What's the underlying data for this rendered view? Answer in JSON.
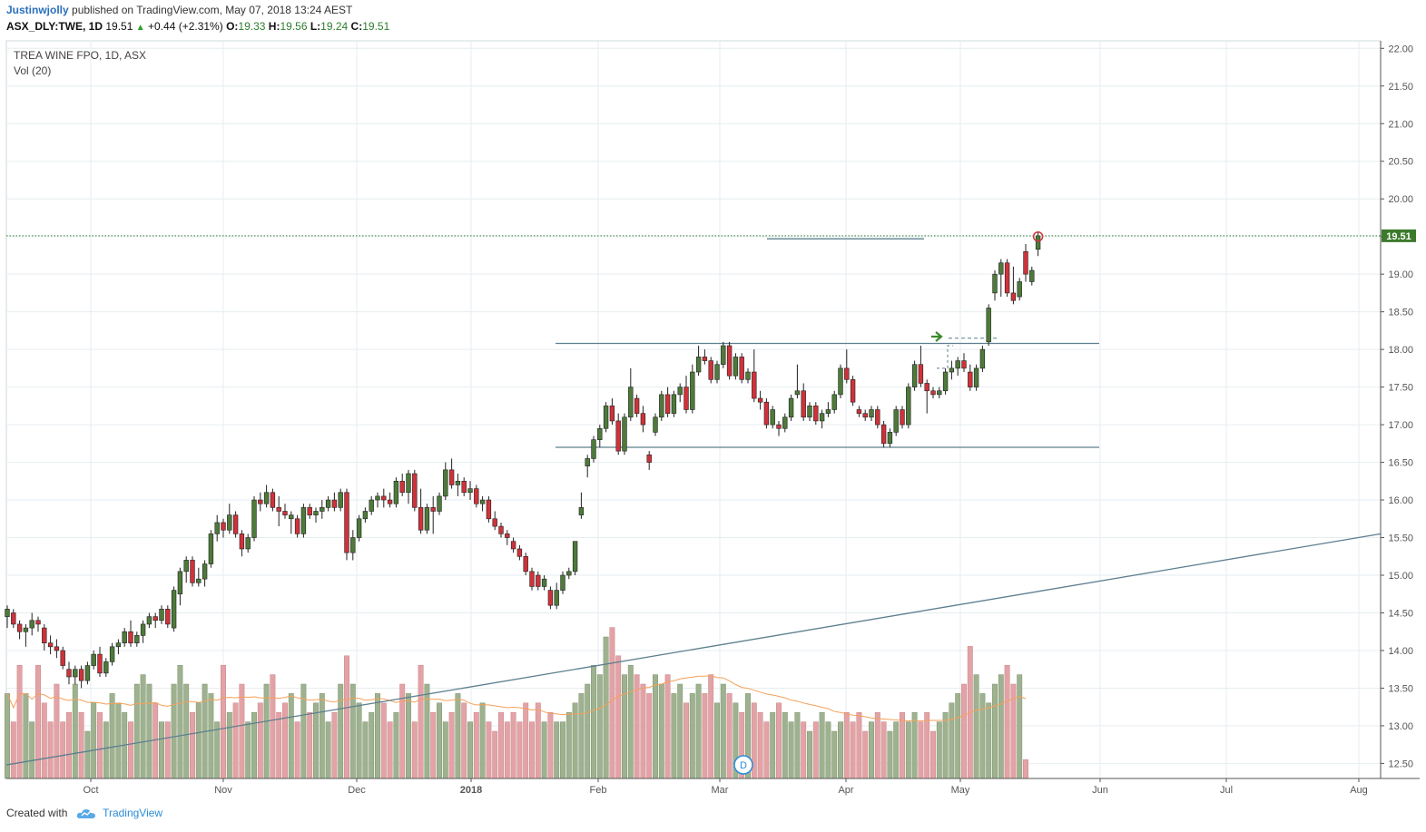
{
  "header": {
    "author": "Justinwjolly",
    "published_text": "published on TradingView.com, May 07, 2018 13:24 AEST",
    "symbol": "ASX_DLY:TWE, 1D",
    "last": "19.51",
    "change": "+0.44 (+2.31%)",
    "open_label": "O:",
    "open": "19.33",
    "high_label": "H:",
    "high": "19.56",
    "low_label": "L:",
    "low": "19.24",
    "close_label": "C:",
    "close": "19.51"
  },
  "legend": {
    "main_series": "TREA WINE FPO, 1D, ASX",
    "volume_series": "Vol (20)"
  },
  "footer": {
    "created_with": "Created with",
    "brand": "TradingView"
  },
  "colors": {
    "up_candle": "#4e7a3a",
    "down_candle": "#d0323a",
    "up_volume": "#9fb28f",
    "down_volume": "#e3a3a6",
    "volume_ma": "#f5a15a",
    "drawing_lines": "#5c7f8e",
    "last_price_line": "#2e7d32",
    "last_price_badge": "#3c7a2c",
    "grid": "#e6eef0"
  },
  "chart_data": {
    "type": "candlestick",
    "symbol": "TWE",
    "interval": "1D",
    "y_axis": {
      "range": [
        12.3,
        22.1
      ],
      "ticks": [
        "12.50",
        "13.00",
        "13.50",
        "14.00",
        "14.50",
        "15.00",
        "15.50",
        "16.00",
        "16.50",
        "17.00",
        "17.50",
        "18.00",
        "18.50",
        "19.00",
        "19.50",
        "20.00",
        "20.50",
        "21.00",
        "21.50",
        "22.00"
      ],
      "last_price_label": "19.51"
    },
    "x_axis": {
      "ticks": [
        "Oct",
        "Nov",
        "Dec",
        "2018",
        "Feb",
        "Mar",
        "Apr",
        "May",
        "Jun",
        "Jul",
        "Aug"
      ]
    },
    "dividend_marker": "D",
    "horizontal_lines": [
      {
        "value": 18.08,
        "from": "2018-01-24",
        "to": "2018-06-01"
      },
      {
        "value": 16.7,
        "from": "2018-01-24",
        "to": "2018-06-01"
      },
      {
        "value": 19.47,
        "from": "2018-03-08",
        "to": "2018-04-24"
      }
    ],
    "trendline": {
      "start_date": "2017-09-13",
      "start_value": 12.48,
      "end_date": "2018-08-01",
      "end_value": 15.55
    },
    "volume_max": 1.0,
    "candles": [
      {
        "o": 14.45,
        "h": 14.6,
        "l": 14.3,
        "c": 14.55
      },
      {
        "o": 14.5,
        "h": 14.55,
        "l": 14.3,
        "c": 14.35
      },
      {
        "o": 14.35,
        "h": 14.4,
        "l": 14.15,
        "c": 14.25
      },
      {
        "o": 14.25,
        "h": 14.35,
        "l": 14.05,
        "c": 14.3
      },
      {
        "o": 14.3,
        "h": 14.5,
        "l": 14.2,
        "c": 14.4
      },
      {
        "o": 14.4,
        "h": 14.45,
        "l": 14.25,
        "c": 14.35
      },
      {
        "o": 14.3,
        "h": 14.35,
        "l": 14.0,
        "c": 14.1
      },
      {
        "o": 14.1,
        "h": 14.2,
        "l": 13.95,
        "c": 14.05
      },
      {
        "o": 14.05,
        "h": 14.15,
        "l": 13.9,
        "c": 14.0
      },
      {
        "o": 14.0,
        "h": 14.05,
        "l": 13.75,
        "c": 13.8
      },
      {
        "o": 13.75,
        "h": 13.85,
        "l": 13.55,
        "c": 13.65
      },
      {
        "o": 13.65,
        "h": 13.8,
        "l": 13.55,
        "c": 13.75
      },
      {
        "o": 13.75,
        "h": 13.8,
        "l": 13.5,
        "c": 13.6
      },
      {
        "o": 13.6,
        "h": 13.85,
        "l": 13.55,
        "c": 13.8
      },
      {
        "o": 13.8,
        "h": 14.0,
        "l": 13.75,
        "c": 13.95
      },
      {
        "o": 13.95,
        "h": 14.05,
        "l": 13.65,
        "c": 13.7
      },
      {
        "o": 13.7,
        "h": 13.9,
        "l": 13.65,
        "c": 13.85
      },
      {
        "o": 13.85,
        "h": 14.1,
        "l": 13.8,
        "c": 14.05
      },
      {
        "o": 14.05,
        "h": 14.15,
        "l": 13.95,
        "c": 14.1
      },
      {
        "o": 14.1,
        "h": 14.3,
        "l": 14.05,
        "c": 14.25
      },
      {
        "o": 14.25,
        "h": 14.4,
        "l": 14.05,
        "c": 14.1
      },
      {
        "o": 14.1,
        "h": 14.25,
        "l": 14.05,
        "c": 14.2
      },
      {
        "o": 14.2,
        "h": 14.4,
        "l": 14.1,
        "c": 14.35
      },
      {
        "o": 14.35,
        "h": 14.5,
        "l": 14.3,
        "c": 14.45
      },
      {
        "o": 14.45,
        "h": 14.5,
        "l": 14.3,
        "c": 14.4
      },
      {
        "o": 14.4,
        "h": 14.6,
        "l": 14.35,
        "c": 14.55
      },
      {
        "o": 14.55,
        "h": 14.6,
        "l": 14.3,
        "c": 14.35
      },
      {
        "o": 14.3,
        "h": 14.85,
        "l": 14.25,
        "c": 14.8
      },
      {
        "o": 14.75,
        "h": 15.1,
        "l": 14.6,
        "c": 15.05
      },
      {
        "o": 15.05,
        "h": 15.25,
        "l": 14.9,
        "c": 15.2
      },
      {
        "o": 15.2,
        "h": 15.25,
        "l": 14.85,
        "c": 14.9
      },
      {
        "o": 14.9,
        "h": 15.1,
        "l": 14.85,
        "c": 14.95
      },
      {
        "o": 14.95,
        "h": 15.2,
        "l": 14.85,
        "c": 15.15
      },
      {
        "o": 15.15,
        "h": 15.6,
        "l": 15.1,
        "c": 15.55
      },
      {
        "o": 15.55,
        "h": 15.8,
        "l": 15.45,
        "c": 15.7
      },
      {
        "o": 15.7,
        "h": 15.75,
        "l": 15.5,
        "c": 15.6
      },
      {
        "o": 15.6,
        "h": 15.95,
        "l": 15.55,
        "c": 15.8
      },
      {
        "o": 15.8,
        "h": 15.85,
        "l": 15.5,
        "c": 15.55
      },
      {
        "o": 15.55,
        "h": 15.6,
        "l": 15.25,
        "c": 15.35
      },
      {
        "o": 15.35,
        "h": 15.55,
        "l": 15.3,
        "c": 15.5
      },
      {
        "o": 15.5,
        "h": 16.05,
        "l": 15.45,
        "c": 16.0
      },
      {
        "o": 16.0,
        "h": 16.1,
        "l": 15.85,
        "c": 15.95
      },
      {
        "o": 15.95,
        "h": 16.2,
        "l": 15.9,
        "c": 16.1
      },
      {
        "o": 16.1,
        "h": 16.15,
        "l": 15.85,
        "c": 15.9
      },
      {
        "o": 15.9,
        "h": 16.05,
        "l": 15.65,
        "c": 15.85
      },
      {
        "o": 15.85,
        "h": 15.95,
        "l": 15.75,
        "c": 15.8
      },
      {
        "o": 15.75,
        "h": 15.85,
        "l": 15.55,
        "c": 15.8
      },
      {
        "o": 15.75,
        "h": 15.8,
        "l": 15.5,
        "c": 15.55
      },
      {
        "o": 15.55,
        "h": 15.95,
        "l": 15.5,
        "c": 15.9
      },
      {
        "o": 15.9,
        "h": 15.95,
        "l": 15.75,
        "c": 15.8
      },
      {
        "o": 15.8,
        "h": 15.9,
        "l": 15.7,
        "c": 15.85
      },
      {
        "o": 15.85,
        "h": 16.0,
        "l": 15.75,
        "c": 15.9
      },
      {
        "o": 15.9,
        "h": 16.05,
        "l": 15.85,
        "c": 16.0
      },
      {
        "o": 16.0,
        "h": 16.1,
        "l": 15.85,
        "c": 15.9
      },
      {
        "o": 15.9,
        "h": 16.15,
        "l": 15.85,
        "c": 16.1
      },
      {
        "o": 16.1,
        "h": 16.15,
        "l": 15.2,
        "c": 15.3
      },
      {
        "o": 15.3,
        "h": 15.6,
        "l": 15.2,
        "c": 15.5
      },
      {
        "o": 15.5,
        "h": 15.8,
        "l": 15.45,
        "c": 15.75
      },
      {
        "o": 15.75,
        "h": 15.9,
        "l": 15.7,
        "c": 15.85
      },
      {
        "o": 15.85,
        "h": 16.05,
        "l": 15.8,
        "c": 16.0
      },
      {
        "o": 16.0,
        "h": 16.1,
        "l": 15.9,
        "c": 16.05
      },
      {
        "o": 16.05,
        "h": 16.15,
        "l": 15.9,
        "c": 16.0
      },
      {
        "o": 16.0,
        "h": 16.1,
        "l": 15.9,
        "c": 15.95
      },
      {
        "o": 15.95,
        "h": 16.3,
        "l": 15.9,
        "c": 16.25
      },
      {
        "o": 16.25,
        "h": 16.35,
        "l": 16.05,
        "c": 16.1
      },
      {
        "o": 16.1,
        "h": 16.4,
        "l": 15.95,
        "c": 16.35
      },
      {
        "o": 16.35,
        "h": 16.4,
        "l": 15.85,
        "c": 15.9
      },
      {
        "o": 15.9,
        "h": 16.15,
        "l": 15.55,
        "c": 15.6
      },
      {
        "o": 15.6,
        "h": 15.95,
        "l": 15.55,
        "c": 15.9
      },
      {
        "o": 15.9,
        "h": 16.05,
        "l": 15.55,
        "c": 15.85
      },
      {
        "o": 15.85,
        "h": 16.1,
        "l": 15.8,
        "c": 16.05
      },
      {
        "o": 16.05,
        "h": 16.5,
        "l": 16.0,
        "c": 16.4
      },
      {
        "o": 16.4,
        "h": 16.55,
        "l": 16.15,
        "c": 16.2
      },
      {
        "o": 16.2,
        "h": 16.35,
        "l": 16.05,
        "c": 16.25
      },
      {
        "o": 16.25,
        "h": 16.3,
        "l": 16.05,
        "c": 16.1
      },
      {
        "o": 16.1,
        "h": 16.25,
        "l": 16.0,
        "c": 16.15
      },
      {
        "o": 16.15,
        "h": 16.2,
        "l": 15.9,
        "c": 15.95
      },
      {
        "o": 15.95,
        "h": 16.05,
        "l": 15.85,
        "c": 16.0
      },
      {
        "o": 16.0,
        "h": 16.05,
        "l": 15.7,
        "c": 15.75
      },
      {
        "o": 15.75,
        "h": 15.85,
        "l": 15.6,
        "c": 15.65
      },
      {
        "o": 15.65,
        "h": 15.7,
        "l": 15.5,
        "c": 15.55
      },
      {
        "o": 15.55,
        "h": 15.6,
        "l": 15.4,
        "c": 15.5
      },
      {
        "o": 15.45,
        "h": 15.5,
        "l": 15.3,
        "c": 15.35
      },
      {
        "o": 15.35,
        "h": 15.4,
        "l": 15.2,
        "c": 15.25
      },
      {
        "o": 15.25,
        "h": 15.3,
        "l": 15.0,
        "c": 15.05
      },
      {
        "o": 15.05,
        "h": 15.1,
        "l": 14.8,
        "c": 14.85
      },
      {
        "o": 15.0,
        "h": 15.05,
        "l": 14.8,
        "c": 14.85
      },
      {
        "o": 14.85,
        "h": 15.0,
        "l": 14.8,
        "c": 14.95
      },
      {
        "o": 14.8,
        "h": 14.85,
        "l": 14.55,
        "c": 14.6
      },
      {
        "o": 14.6,
        "h": 14.9,
        "l": 14.55,
        "c": 14.8
      },
      {
        "o": 14.8,
        "h": 15.05,
        "l": 14.75,
        "c": 15.0
      },
      {
        "o": 15.0,
        "h": 15.1,
        "l": 14.95,
        "c": 15.05
      },
      {
        "o": 15.05,
        "h": 15.45,
        "l": 15.0,
        "c": 15.45
      },
      {
        "o": 15.8,
        "h": 16.1,
        "l": 15.75,
        "c": 15.9
      },
      {
        "o": 16.45,
        "h": 16.6,
        "l": 16.3,
        "c": 16.55
      },
      {
        "o": 16.55,
        "h": 16.85,
        "l": 16.5,
        "c": 16.8
      },
      {
        "o": 16.8,
        "h": 17.0,
        "l": 16.7,
        "c": 16.95
      },
      {
        "o": 16.95,
        "h": 17.3,
        "l": 16.9,
        "c": 17.25
      },
      {
        "o": 17.25,
        "h": 17.35,
        "l": 17.0,
        "c": 17.05
      },
      {
        "o": 17.05,
        "h": 17.15,
        "l": 16.6,
        "c": 16.65
      },
      {
        "o": 16.65,
        "h": 17.15,
        "l": 16.6,
        "c": 17.1
      },
      {
        "o": 17.1,
        "h": 17.75,
        "l": 17.05,
        "c": 17.5
      },
      {
        "o": 17.35,
        "h": 17.4,
        "l": 17.1,
        "c": 17.15
      },
      {
        "o": 17.15,
        "h": 17.25,
        "l": 16.9,
        "c": 17.0
      },
      {
        "o": 16.6,
        "h": 16.65,
        "l": 16.4,
        "c": 16.5
      },
      {
        "o": 16.9,
        "h": 17.15,
        "l": 16.85,
        "c": 17.1
      },
      {
        "o": 17.1,
        "h": 17.45,
        "l": 17.05,
        "c": 17.4
      },
      {
        "o": 17.4,
        "h": 17.5,
        "l": 17.1,
        "c": 17.15
      },
      {
        "o": 17.15,
        "h": 17.45,
        "l": 17.1,
        "c": 17.4
      },
      {
        "o": 17.4,
        "h": 17.55,
        "l": 17.3,
        "c": 17.5
      },
      {
        "o": 17.5,
        "h": 17.65,
        "l": 17.15,
        "c": 17.2
      },
      {
        "o": 17.2,
        "h": 17.8,
        "l": 17.15,
        "c": 17.7
      },
      {
        "o": 17.7,
        "h": 18.05,
        "l": 17.65,
        "c": 17.9
      },
      {
        "o": 17.9,
        "h": 18.0,
        "l": 17.8,
        "c": 17.85
      },
      {
        "o": 17.85,
        "h": 17.9,
        "l": 17.55,
        "c": 17.6
      },
      {
        "o": 17.6,
        "h": 17.85,
        "l": 17.55,
        "c": 17.8
      },
      {
        "o": 17.8,
        "h": 18.1,
        "l": 17.75,
        "c": 18.05
      },
      {
        "o": 18.05,
        "h": 18.1,
        "l": 17.6,
        "c": 17.65
      },
      {
        "o": 17.65,
        "h": 17.95,
        "l": 17.6,
        "c": 17.9
      },
      {
        "o": 17.9,
        "h": 17.95,
        "l": 17.55,
        "c": 17.6
      },
      {
        "o": 17.6,
        "h": 17.75,
        "l": 17.55,
        "c": 17.7
      },
      {
        "o": 17.7,
        "h": 18.0,
        "l": 17.3,
        "c": 17.35
      },
      {
        "o": 17.35,
        "h": 17.45,
        "l": 17.2,
        "c": 17.3
      },
      {
        "o": 17.3,
        "h": 17.35,
        "l": 16.95,
        "c": 17.0
      },
      {
        "o": 17.0,
        "h": 17.25,
        "l": 16.95,
        "c": 17.2
      },
      {
        "o": 17.0,
        "h": 17.05,
        "l": 16.85,
        "c": 16.95
      },
      {
        "o": 16.95,
        "h": 17.15,
        "l": 16.9,
        "c": 17.1
      },
      {
        "o": 17.1,
        "h": 17.4,
        "l": 17.05,
        "c": 17.35
      },
      {
        "o": 17.4,
        "h": 17.8,
        "l": 17.35,
        "c": 17.45
      },
      {
        "o": 17.45,
        "h": 17.55,
        "l": 17.05,
        "c": 17.1
      },
      {
        "o": 17.1,
        "h": 17.3,
        "l": 17.05,
        "c": 17.25
      },
      {
        "o": 17.25,
        "h": 17.3,
        "l": 17.0,
        "c": 17.05
      },
      {
        "o": 17.05,
        "h": 17.2,
        "l": 16.95,
        "c": 17.15
      },
      {
        "o": 17.15,
        "h": 17.3,
        "l": 17.1,
        "c": 17.2
      },
      {
        "o": 17.2,
        "h": 17.45,
        "l": 17.15,
        "c": 17.4
      },
      {
        "o": 17.4,
        "h": 17.8,
        "l": 17.35,
        "c": 17.75
      },
      {
        "o": 17.75,
        "h": 18.0,
        "l": 17.55,
        "c": 17.6
      },
      {
        "o": 17.6,
        "h": 17.65,
        "l": 17.25,
        "c": 17.3
      },
      {
        "o": 17.2,
        "h": 17.25,
        "l": 17.1,
        "c": 17.15
      },
      {
        "o": 17.15,
        "h": 17.2,
        "l": 17.05,
        "c": 17.1
      },
      {
        "o": 17.1,
        "h": 17.25,
        "l": 17.05,
        "c": 17.2
      },
      {
        "o": 17.2,
        "h": 17.25,
        "l": 16.95,
        "c": 17.0
      },
      {
        "o": 17.0,
        "h": 17.05,
        "l": 16.7,
        "c": 16.75
      },
      {
        "o": 16.75,
        "h": 16.95,
        "l": 16.7,
        "c": 16.9
      },
      {
        "o": 16.9,
        "h": 17.25,
        "l": 16.85,
        "c": 17.2
      },
      {
        "o": 17.2,
        "h": 17.25,
        "l": 16.95,
        "c": 17.0
      },
      {
        "o": 17.0,
        "h": 17.55,
        "l": 16.95,
        "c": 17.5
      },
      {
        "o": 17.5,
        "h": 17.85,
        "l": 17.45,
        "c": 17.8
      },
      {
        "o": 17.8,
        "h": 18.05,
        "l": 17.5,
        "c": 17.55
      },
      {
        "o": 17.55,
        "h": 17.6,
        "l": 17.15,
        "c": 17.45
      },
      {
        "o": 17.45,
        "h": 17.5,
        "l": 17.35,
        "c": 17.4
      },
      {
        "o": 17.4,
        "h": 17.5,
        "l": 17.35,
        "c": 17.45
      },
      {
        "o": 17.45,
        "h": 17.75,
        "l": 17.4,
        "c": 17.7
      },
      {
        "o": 17.7,
        "h": 17.85,
        "l": 17.6,
        "c": 17.75
      },
      {
        "o": 17.75,
        "h": 17.9,
        "l": 17.65,
        "c": 17.85
      },
      {
        "o": 17.85,
        "h": 17.95,
        "l": 17.7,
        "c": 17.75
      },
      {
        "o": 17.7,
        "h": 17.8,
        "l": 17.45,
        "c": 17.5
      },
      {
        "o": 17.5,
        "h": 17.8,
        "l": 17.45,
        "c": 17.75
      },
      {
        "o": 17.75,
        "h": 18.05,
        "l": 17.7,
        "c": 18.0
      },
      {
        "o": 18.1,
        "h": 18.6,
        "l": 18.05,
        "c": 18.55
      },
      {
        "o": 18.75,
        "h": 19.05,
        "l": 18.65,
        "c": 19.0
      },
      {
        "o": 19.0,
        "h": 19.2,
        "l": 18.7,
        "c": 19.15
      },
      {
        "o": 19.15,
        "h": 19.2,
        "l": 18.7,
        "c": 18.75
      },
      {
        "o": 18.75,
        "h": 19.1,
        "l": 18.6,
        "c": 18.65
      },
      {
        "o": 18.7,
        "h": 18.95,
        "l": 18.65,
        "c": 18.9
      },
      {
        "o": 19.3,
        "h": 19.4,
        "l": 18.9,
        "c": 19.0
      },
      {
        "o": 18.9,
        "h": 19.1,
        "l": 18.85,
        "c": 19.05
      },
      {
        "o": 19.33,
        "h": 19.56,
        "l": 19.24,
        "c": 19.51
      }
    ],
    "volume": [
      0.45,
      0.3,
      0.6,
      0.45,
      0.3,
      0.6,
      0.4,
      0.3,
      0.5,
      0.3,
      0.35,
      0.5,
      0.35,
      0.25,
      0.4,
      0.35,
      0.3,
      0.45,
      0.4,
      0.35,
      0.3,
      0.5,
      0.55,
      0.5,
      0.4,
      0.3,
      0.3,
      0.5,
      0.6,
      0.5,
      0.35,
      0.4,
      0.5,
      0.45,
      0.3,
      0.6,
      0.35,
      0.4,
      0.5,
      0.3,
      0.35,
      0.4,
      0.5,
      0.55,
      0.35,
      0.4,
      0.45,
      0.3,
      0.5,
      0.35,
      0.4,
      0.45,
      0.3,
      0.35,
      0.5,
      0.65,
      0.5,
      0.4,
      0.3,
      0.35,
      0.45,
      0.4,
      0.3,
      0.35,
      0.5,
      0.45,
      0.3,
      0.6,
      0.5,
      0.35,
      0.4,
      0.3,
      0.35,
      0.45,
      0.4,
      0.3,
      0.35,
      0.4,
      0.3,
      0.25,
      0.35,
      0.3,
      0.35,
      0.3,
      0.4,
      0.3,
      0.4,
      0.3,
      0.35,
      0.3,
      0.3,
      0.35,
      0.4,
      0.45,
      0.5,
      0.6,
      0.55,
      0.75,
      0.8,
      0.65,
      0.55,
      0.6,
      0.55,
      0.5,
      0.45,
      0.55,
      0.5,
      0.55,
      0.45,
      0.5,
      0.4,
      0.45,
      0.5,
      0.45,
      0.55,
      0.4,
      0.5,
      0.45,
      0.4,
      0.35,
      0.45,
      0.4,
      0.35,
      0.3,
      0.35,
      0.4,
      0.35,
      0.3,
      0.35,
      0.3,
      0.25,
      0.3,
      0.35,
      0.3,
      0.25,
      0.3,
      0.35,
      0.3,
      0.35,
      0.25,
      0.3,
      0.35,
      0.3,
      0.25,
      0.3,
      0.35,
      0.3,
      0.35,
      0.3,
      0.35,
      0.25,
      0.3,
      0.35,
      0.4,
      0.45,
      0.5,
      0.7,
      0.55,
      0.45,
      0.4,
      0.5,
      0.55,
      0.6,
      0.5,
      0.55,
      0.1
    ],
    "volume_colors_follow_candles": true
  }
}
